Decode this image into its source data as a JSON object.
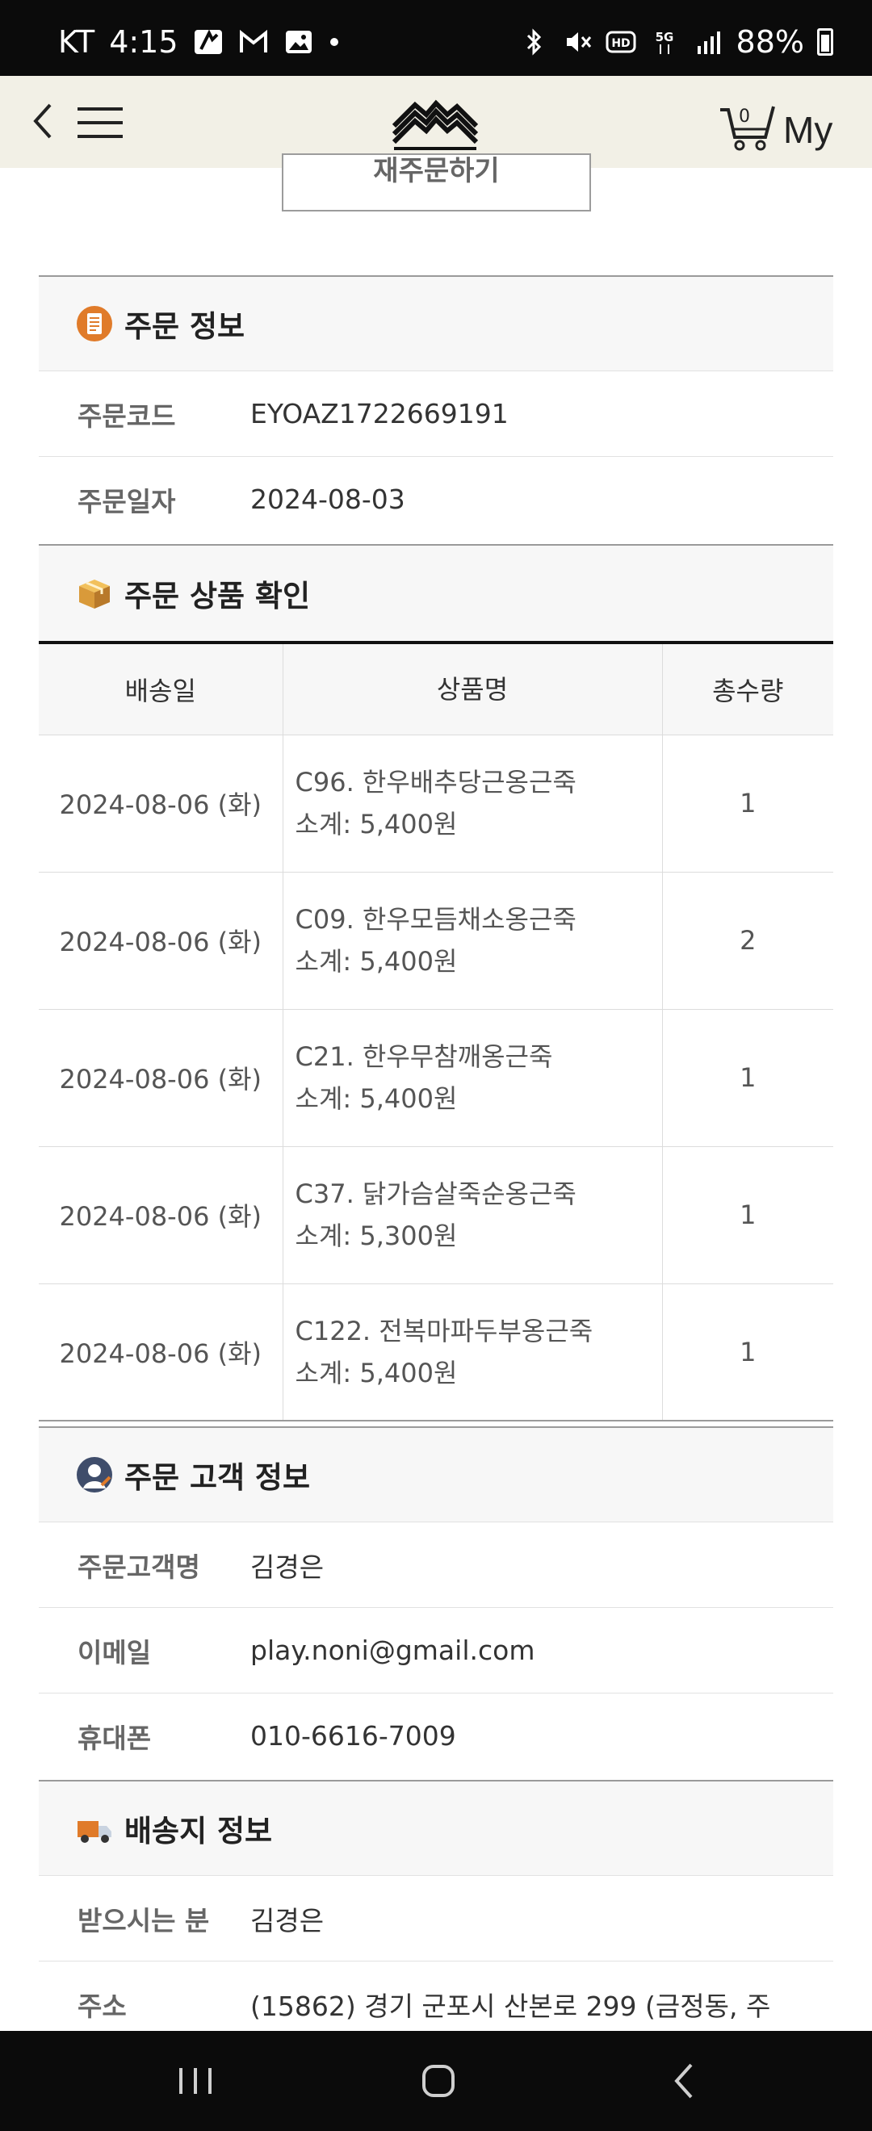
{
  "status_bar": {
    "carrier": "KT",
    "time": "4:15",
    "battery": "88%",
    "icons": [
      "app-notification-icon",
      "gmail-icon",
      "gallery-icon",
      "dot-icon",
      "bluetooth-icon",
      "mute-icon",
      "hd-icon",
      "5g-icon",
      "signal-icon",
      "battery-icon"
    ]
  },
  "header": {
    "cart_count": "0",
    "my_label": "My"
  },
  "reorder_button": {
    "label": "재주문하기"
  },
  "order_info": {
    "title": "주문 정보",
    "rows": [
      {
        "label": "주문코드",
        "value": "EYOAZ1722669191"
      },
      {
        "label": "주문일자",
        "value": "2024-08-03"
      }
    ]
  },
  "order_products": {
    "title": "주문 상품 확인",
    "headers": {
      "date": "배송일",
      "name": "상품명",
      "qty": "총수량"
    },
    "items": [
      {
        "date": "2024-08-06 (화)",
        "name": "C96. 한우배추당근옹근죽",
        "subtotal": "소계: 5,400원",
        "qty": "1"
      },
      {
        "date": "2024-08-06 (화)",
        "name": "C09. 한우모듬채소옹근죽",
        "subtotal": "소계: 5,400원",
        "qty": "2"
      },
      {
        "date": "2024-08-06 (화)",
        "name": "C21. 한우무참깨옹근죽",
        "subtotal": "소계: 5,400원",
        "qty": "1"
      },
      {
        "date": "2024-08-06 (화)",
        "name": "C37. 닭가슴살죽순옹근죽",
        "subtotal": "소계: 5,300원",
        "qty": "1"
      },
      {
        "date": "2024-08-06 (화)",
        "name": "C122. 전복마파두부옹근죽",
        "subtotal": "소계: 5,400원",
        "qty": "1"
      }
    ]
  },
  "customer_info": {
    "title": "주문 고객 정보",
    "rows": [
      {
        "label": "주문고객명",
        "value": "김경은"
      },
      {
        "label": "이메일",
        "value": "play.noni@gmail.com"
      },
      {
        "label": "휴대폰",
        "value": "010-6616-7009"
      }
    ]
  },
  "shipping_info": {
    "title": "배송지 정보",
    "rows": [
      {
        "label": "받으시는 분",
        "value": "김경은"
      },
      {
        "label": "주소",
        "value": "(15862) 경기 군포시 산본로 299 (금정동, 주"
      }
    ]
  },
  "colors": {
    "accent_orange": "#e07b2a",
    "header_bg": "#f2f0e6",
    "section_bg": "#f7f7f7"
  }
}
